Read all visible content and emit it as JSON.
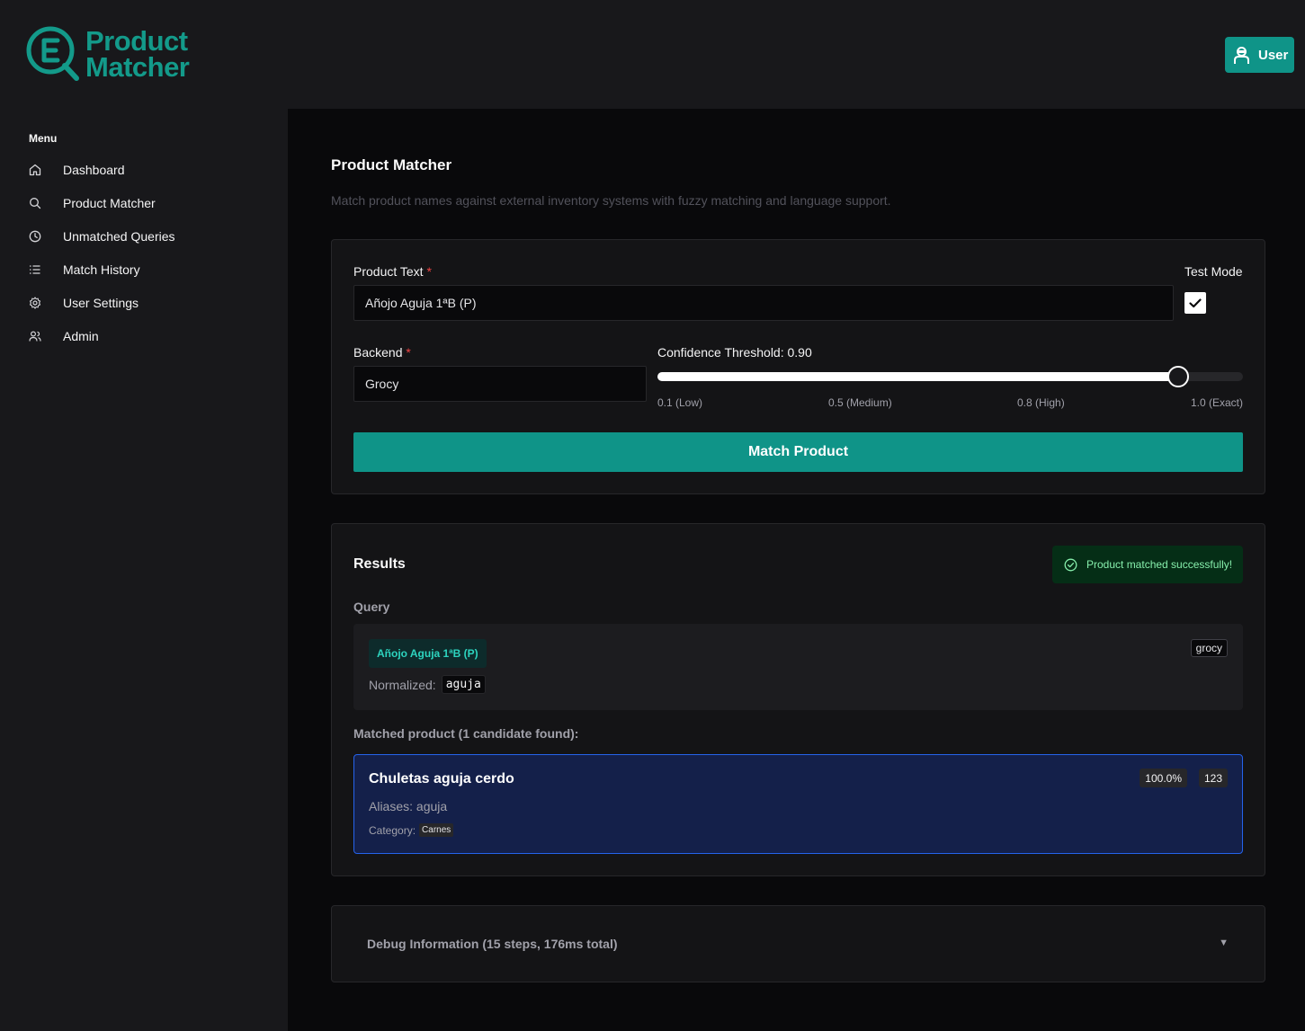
{
  "header": {
    "logo_line1": "Product",
    "logo_line2": "Matcher",
    "user_label": "User"
  },
  "sidebar": {
    "menu_title": "Menu",
    "items": [
      {
        "label": "Dashboard",
        "icon": "home-icon"
      },
      {
        "label": "Product Matcher",
        "icon": "search-icon"
      },
      {
        "label": "Unmatched Queries",
        "icon": "clock-icon"
      },
      {
        "label": "Match History",
        "icon": "list-icon"
      },
      {
        "label": "User Settings",
        "icon": "gear-icon"
      },
      {
        "label": "Admin",
        "icon": "users-icon"
      }
    ]
  },
  "page": {
    "title": "Product Matcher",
    "subtitle": "Match product names against external inventory systems with fuzzy matching and language support."
  },
  "form": {
    "product_text_label": "Product Text",
    "required_mark": "*",
    "product_text_value": "Añojo Aguja 1ªB (P)",
    "test_mode_label": "Test Mode",
    "test_mode_checked": true,
    "backend_label": "Backend",
    "backend_value": "Grocy",
    "confidence_label": "Confidence Threshold: 0.90",
    "confidence_value": 0.9,
    "slider_min": 0.1,
    "slider_max": 1.0,
    "ticks": [
      "0.1 (Low)",
      "0.5 (Medium)",
      "0.8 (High)",
      "1.0 (Exact)"
    ],
    "submit_label": "Match Product"
  },
  "results": {
    "title": "Results",
    "success_message": "Product matched successfully!",
    "query_label": "Query",
    "query_text": "Añojo Aguja 1ªB (P)",
    "backend_tag": "grocy",
    "normalized_label": "Normalized:",
    "normalized_value": "aguja",
    "matched_label": "Matched product (1 candidate found):",
    "match": {
      "name": "Chuletas aguja cerdo",
      "aliases": "Aliases: aguja",
      "category_label": "Category:",
      "category": "Carnes",
      "score": "100.0%",
      "id": "123"
    }
  },
  "debug": {
    "title": "Debug Information (15 steps, 176ms total)",
    "caret": "▼"
  },
  "colors": {
    "accent": "#0f9488",
    "success_bg": "#052e16",
    "success_text": "#86efac",
    "match_border": "#2563eb"
  }
}
